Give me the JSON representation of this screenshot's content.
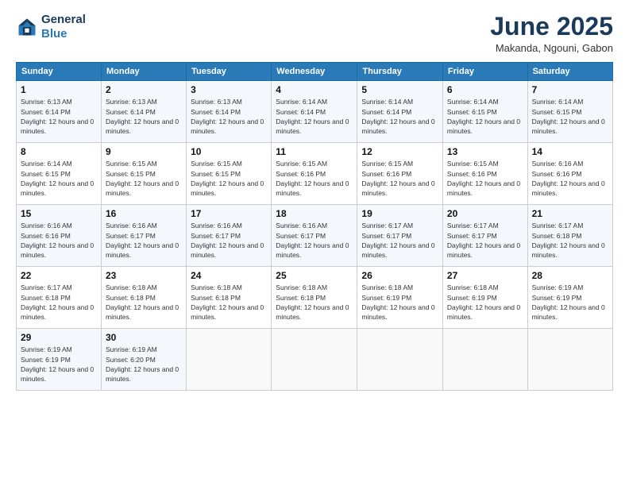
{
  "header": {
    "logo_line1": "General",
    "logo_line2": "Blue",
    "month_title": "June 2025",
    "location": "Makanda, Ngouni, Gabon"
  },
  "days_of_week": [
    "Sunday",
    "Monday",
    "Tuesday",
    "Wednesday",
    "Thursday",
    "Friday",
    "Saturday"
  ],
  "weeks": [
    [
      {
        "day": 1,
        "sunrise": "6:13 AM",
        "sunset": "6:14 PM",
        "daylight": "12 hours and 0 minutes."
      },
      {
        "day": 2,
        "sunrise": "6:13 AM",
        "sunset": "6:14 PM",
        "daylight": "12 hours and 0 minutes."
      },
      {
        "day": 3,
        "sunrise": "6:13 AM",
        "sunset": "6:14 PM",
        "daylight": "12 hours and 0 minutes."
      },
      {
        "day": 4,
        "sunrise": "6:14 AM",
        "sunset": "6:14 PM",
        "daylight": "12 hours and 0 minutes."
      },
      {
        "day": 5,
        "sunrise": "6:14 AM",
        "sunset": "6:14 PM",
        "daylight": "12 hours and 0 minutes."
      },
      {
        "day": 6,
        "sunrise": "6:14 AM",
        "sunset": "6:15 PM",
        "daylight": "12 hours and 0 minutes."
      },
      {
        "day": 7,
        "sunrise": "6:14 AM",
        "sunset": "6:15 PM",
        "daylight": "12 hours and 0 minutes."
      }
    ],
    [
      {
        "day": 8,
        "sunrise": "6:14 AM",
        "sunset": "6:15 PM",
        "daylight": "12 hours and 0 minutes."
      },
      {
        "day": 9,
        "sunrise": "6:15 AM",
        "sunset": "6:15 PM",
        "daylight": "12 hours and 0 minutes."
      },
      {
        "day": 10,
        "sunrise": "6:15 AM",
        "sunset": "6:15 PM",
        "daylight": "12 hours and 0 minutes."
      },
      {
        "day": 11,
        "sunrise": "6:15 AM",
        "sunset": "6:16 PM",
        "daylight": "12 hours and 0 minutes."
      },
      {
        "day": 12,
        "sunrise": "6:15 AM",
        "sunset": "6:16 PM",
        "daylight": "12 hours and 0 minutes."
      },
      {
        "day": 13,
        "sunrise": "6:15 AM",
        "sunset": "6:16 PM",
        "daylight": "12 hours and 0 minutes."
      },
      {
        "day": 14,
        "sunrise": "6:16 AM",
        "sunset": "6:16 PM",
        "daylight": "12 hours and 0 minutes."
      }
    ],
    [
      {
        "day": 15,
        "sunrise": "6:16 AM",
        "sunset": "6:16 PM",
        "daylight": "12 hours and 0 minutes."
      },
      {
        "day": 16,
        "sunrise": "6:16 AM",
        "sunset": "6:17 PM",
        "daylight": "12 hours and 0 minutes."
      },
      {
        "day": 17,
        "sunrise": "6:16 AM",
        "sunset": "6:17 PM",
        "daylight": "12 hours and 0 minutes."
      },
      {
        "day": 18,
        "sunrise": "6:16 AM",
        "sunset": "6:17 PM",
        "daylight": "12 hours and 0 minutes."
      },
      {
        "day": 19,
        "sunrise": "6:17 AM",
        "sunset": "6:17 PM",
        "daylight": "12 hours and 0 minutes."
      },
      {
        "day": 20,
        "sunrise": "6:17 AM",
        "sunset": "6:17 PM",
        "daylight": "12 hours and 0 minutes."
      },
      {
        "day": 21,
        "sunrise": "6:17 AM",
        "sunset": "6:18 PM",
        "daylight": "12 hours and 0 minutes."
      }
    ],
    [
      {
        "day": 22,
        "sunrise": "6:17 AM",
        "sunset": "6:18 PM",
        "daylight": "12 hours and 0 minutes."
      },
      {
        "day": 23,
        "sunrise": "6:18 AM",
        "sunset": "6:18 PM",
        "daylight": "12 hours and 0 minutes."
      },
      {
        "day": 24,
        "sunrise": "6:18 AM",
        "sunset": "6:18 PM",
        "daylight": "12 hours and 0 minutes."
      },
      {
        "day": 25,
        "sunrise": "6:18 AM",
        "sunset": "6:18 PM",
        "daylight": "12 hours and 0 minutes."
      },
      {
        "day": 26,
        "sunrise": "6:18 AM",
        "sunset": "6:19 PM",
        "daylight": "12 hours and 0 minutes."
      },
      {
        "day": 27,
        "sunrise": "6:18 AM",
        "sunset": "6:19 PM",
        "daylight": "12 hours and 0 minutes."
      },
      {
        "day": 28,
        "sunrise": "6:19 AM",
        "sunset": "6:19 PM",
        "daylight": "12 hours and 0 minutes."
      }
    ],
    [
      {
        "day": 29,
        "sunrise": "6:19 AM",
        "sunset": "6:19 PM",
        "daylight": "12 hours and 0 minutes."
      },
      {
        "day": 30,
        "sunrise": "6:19 AM",
        "sunset": "6:20 PM",
        "daylight": "12 hours and 0 minutes."
      },
      null,
      null,
      null,
      null,
      null
    ]
  ]
}
